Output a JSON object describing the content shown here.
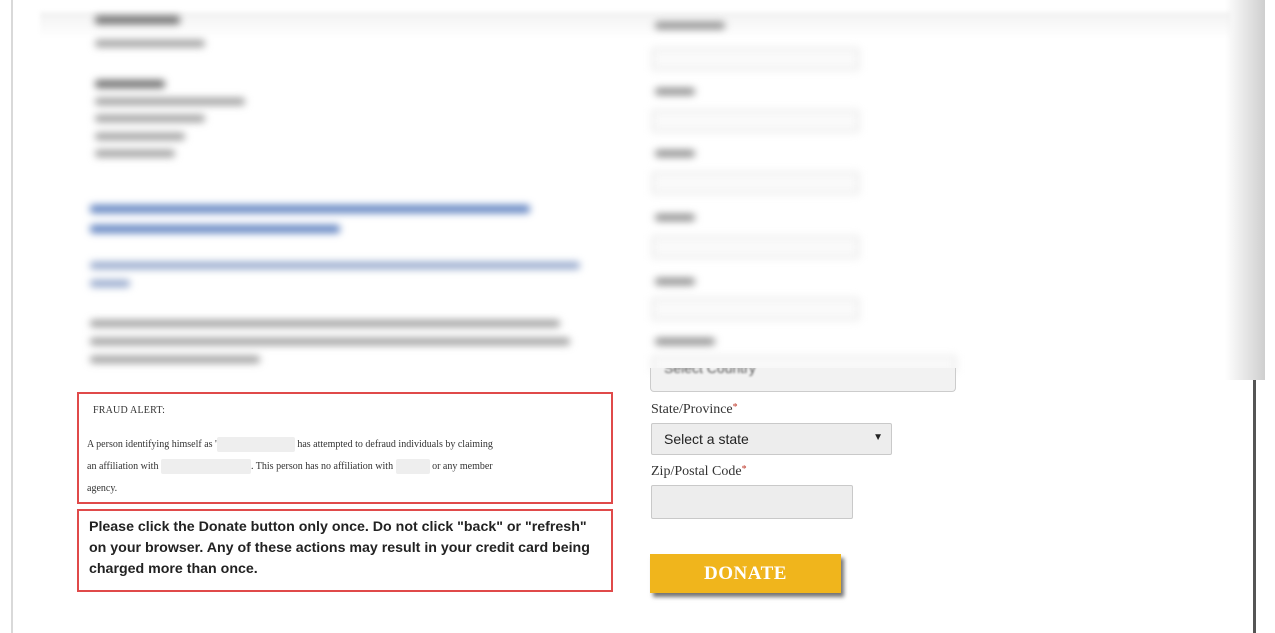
{
  "fraud_alert": {
    "title": "FRAUD ALERT:",
    "line1_pre": "A person identifying himself as '",
    "line1_post": "has attempted to defraud individuals by claiming",
    "line2_pre": "an affiliation with",
    "line2_mid": ". This person has no affiliation with",
    "line2_post": "or any member",
    "line3": "agency."
  },
  "donate_notice": "Please click the Donate button only once. Do not click \"back\" or \"refresh\" on your browser. Any of these actions may result in your credit card being charged more than once.",
  "form": {
    "country_partial": "Select Country",
    "state_label": "State/Province",
    "state_required": "*",
    "state_value": "Select a state",
    "state_arrow": "▼",
    "zip_label": "Zip/Postal Code",
    "zip_required": "*",
    "zip_value": ""
  },
  "donate_button": "DONATE",
  "colors": {
    "alert_border": "#e04a4a",
    "donate_bg": "#f0b51c",
    "required": "#c0392b"
  }
}
